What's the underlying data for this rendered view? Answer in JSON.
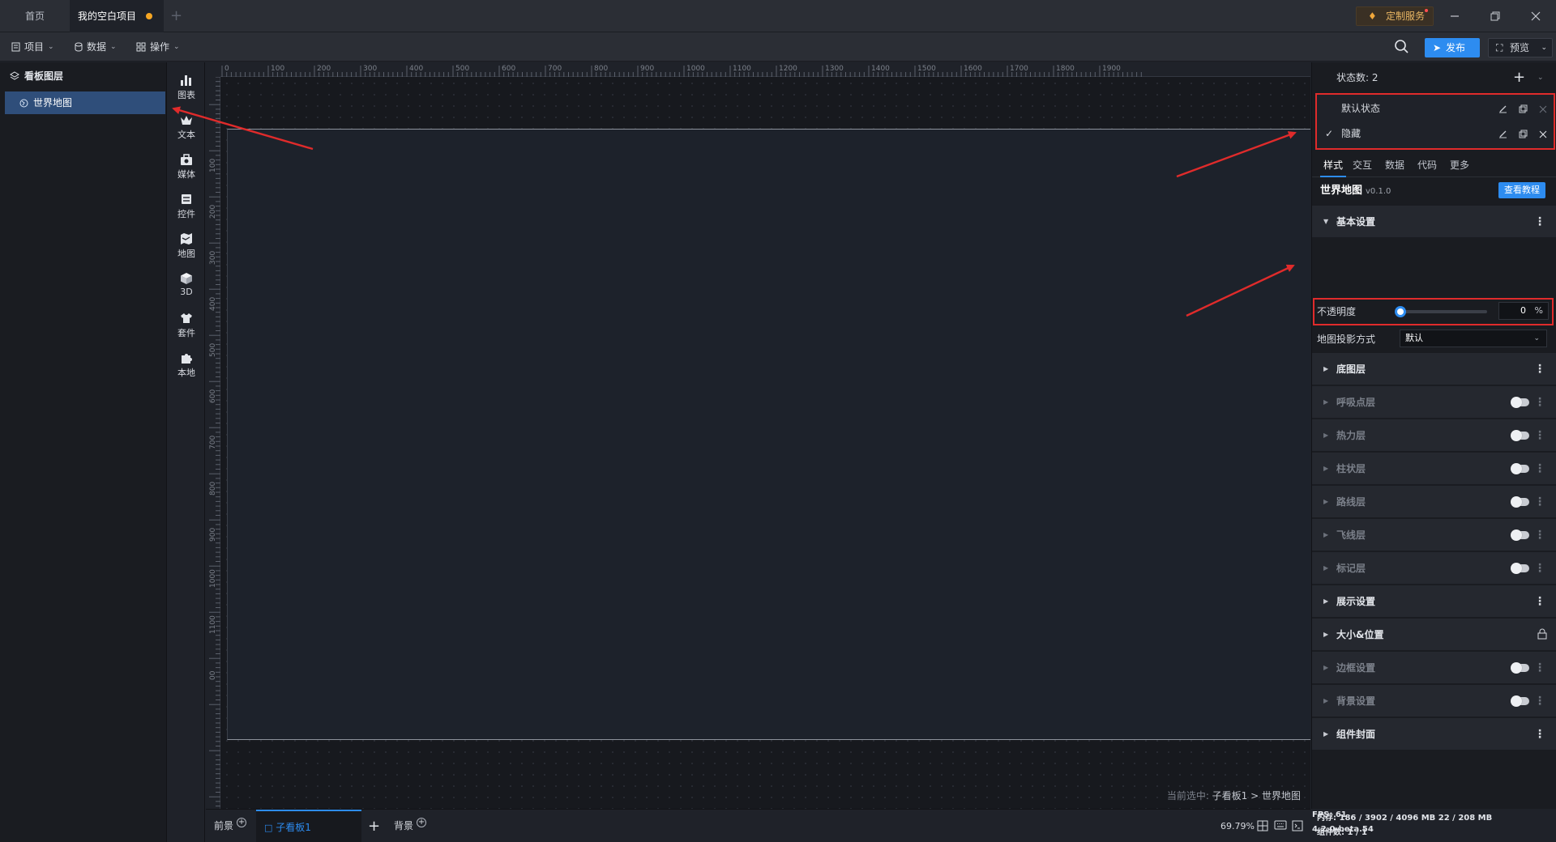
{
  "titlebar": {
    "tabs": [
      {
        "label": "首页"
      },
      {
        "label": "我的空白项目"
      }
    ],
    "custom_service": "定制服务"
  },
  "toolbar": {
    "menus": [
      {
        "label": "项目",
        "icon": "file-icon"
      },
      {
        "label": "数据",
        "icon": "database-icon"
      },
      {
        "label": "操作",
        "icon": "grid-icon"
      }
    ],
    "publish": "发布",
    "preview": "预览"
  },
  "layers": {
    "title": "看板图层",
    "items": [
      {
        "label": "世界地图"
      }
    ]
  },
  "components": [
    {
      "label": "图表",
      "icon": "bar-chart-icon"
    },
    {
      "label": "文本",
      "icon": "text-icon"
    },
    {
      "label": "媒体",
      "icon": "media-icon"
    },
    {
      "label": "控件",
      "icon": "widget-icon"
    },
    {
      "label": "地图",
      "icon": "map-icon"
    },
    {
      "label": "3D",
      "icon": "cube-icon"
    },
    {
      "label": "套件",
      "icon": "shirt-icon"
    },
    {
      "label": "本地",
      "icon": "puzzle-icon"
    }
  ],
  "canvas": {
    "ruler_x": [
      "0",
      "100",
      "200",
      "300",
      "400",
      "500",
      "600",
      "700",
      "800",
      "900",
      "1000",
      "1100",
      "1200",
      "1300",
      "1400",
      "1500",
      "1600",
      "1700",
      "1800",
      "1900"
    ],
    "ruler_y": [
      "100",
      "200",
      "300",
      "400",
      "500",
      "600",
      "700",
      "800",
      "900",
      "1000",
      "1100",
      "00"
    ],
    "selection_prefix": "当前选中: ",
    "selection_path": "子看板1 > 世界地图"
  },
  "bottombar": {
    "tabs": [
      {
        "label": "前景"
      },
      {
        "label": "子看板1"
      },
      {
        "label": "背景"
      }
    ],
    "zoom": "69.79%"
  },
  "rightpanel": {
    "state_count_label": "状态数: 2",
    "states": [
      {
        "label": "默认状态",
        "checked": false
      },
      {
        "label": "隐藏",
        "checked": true
      }
    ],
    "tabs": [
      {
        "label": "样式"
      },
      {
        "label": "交互"
      },
      {
        "label": "数据"
      },
      {
        "label": "代码"
      },
      {
        "label": "更多"
      }
    ],
    "component_name": "世界地图",
    "component_version": "v0.1.0",
    "tutorial_button": "查看教程",
    "basic_settings": "基本设置",
    "opacity": {
      "label": "不透明度",
      "value": "0",
      "unit": "%",
      "level": 0
    },
    "projection": {
      "label": "地图投影方式",
      "value": "默认"
    },
    "sections": [
      {
        "label": "底图层",
        "enabled": true,
        "control": "more"
      },
      {
        "label": "呼吸点层",
        "enabled": false,
        "control": "toggle"
      },
      {
        "label": "热力层",
        "enabled": false,
        "control": "toggle"
      },
      {
        "label": "柱状层",
        "enabled": false,
        "control": "toggle"
      },
      {
        "label": "路线层",
        "enabled": false,
        "control": "toggle"
      },
      {
        "label": "飞线层",
        "enabled": false,
        "control": "toggle"
      },
      {
        "label": "标记层",
        "enabled": false,
        "control": "toggle"
      },
      {
        "label": "展示设置",
        "enabled": true,
        "control": "more"
      },
      {
        "label": "大小&位置",
        "enabled": true,
        "control": "lock"
      },
      {
        "label": "边框设置",
        "enabled": false,
        "control": "toggle"
      },
      {
        "label": "背景设置",
        "enabled": false,
        "control": "toggle"
      },
      {
        "label": "组件封面",
        "enabled": true,
        "control": "more"
      }
    ],
    "status": {
      "memory": "内存: 186 / 3902 / 4096 MB  22 / 208 MB",
      "fps": "FPS: 61",
      "component_count": "组件数: 1 / 1",
      "version": "4.2.0-beta.54"
    }
  },
  "colors": {
    "accent": "#2d8cf0",
    "highlight_box": "#e02b2b",
    "arrow": "#e02b2b",
    "unsaved_dot": "#f5a623"
  }
}
